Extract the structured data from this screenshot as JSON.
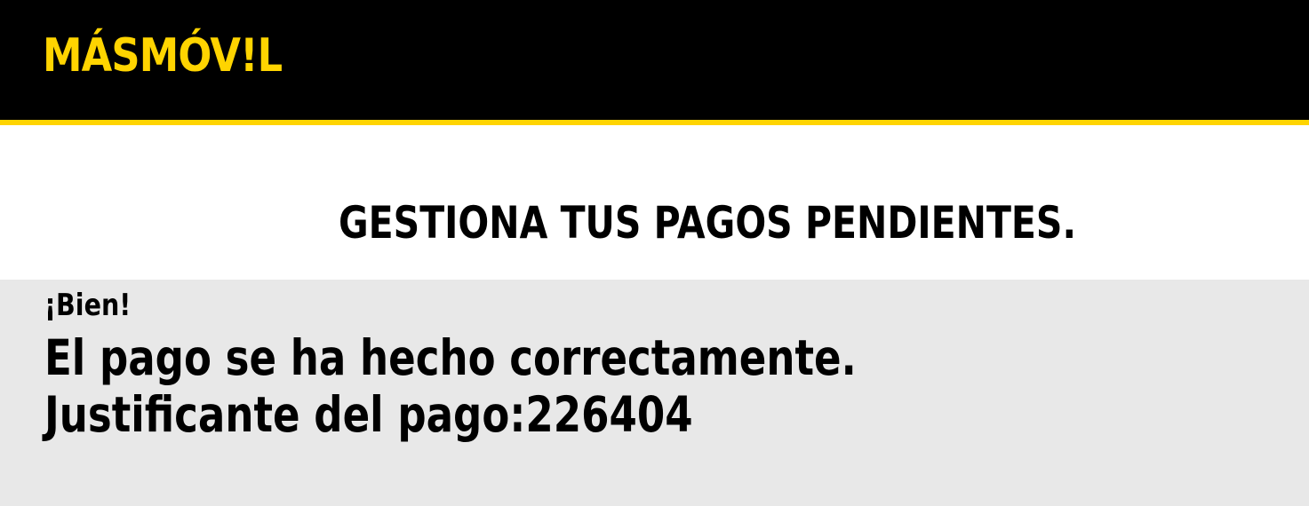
{
  "brand": {
    "logo_text": "MÁSMÓV!L",
    "logo_color": "#ffd400",
    "header_bg": "#000000",
    "accent_line_color": "#ffd400"
  },
  "page": {
    "title": "GESTIONA TUS PAGOS PENDIENTES."
  },
  "payment_result": {
    "kicker": "¡Bien!",
    "message": "El pago se ha hecho correctamente.",
    "receipt_label": "Justificante del pago:",
    "receipt_number": "226404",
    "panel_bg": "#e8e8e8"
  }
}
